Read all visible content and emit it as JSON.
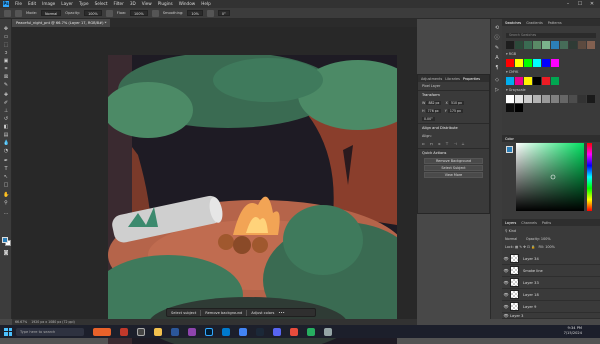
{
  "app": {
    "logo": "Ps",
    "menu": [
      "File",
      "Edit",
      "Image",
      "Layer",
      "Type",
      "Select",
      "Filter",
      "3D",
      "View",
      "Plugins",
      "Window",
      "Help"
    ],
    "window_controls": [
      "–",
      "☐",
      "✕"
    ]
  },
  "options": {
    "mode_label": "Mode:",
    "mode_value": "Normal",
    "opacity_label": "Opacity:",
    "opacity_value": "100%",
    "flow_label": "Flow:",
    "flow_value": "100%",
    "smoothing_label": "Smoothing:",
    "smoothing_value": "10%",
    "angle_value": "0°"
  },
  "document": {
    "tab_title": "Peaceful_night_pnt @ 66.7% (Layer 17, RGB/8#) *",
    "status_zoom": "66.67%",
    "status_size": "1920 px x 1080 px (72 ppi)"
  },
  "contextual_bar": {
    "select_subject": "Select subject",
    "remove_background": "Remove background",
    "adjust_colors": "Adjust colors"
  },
  "properties": {
    "tabs": [
      "Adjustments",
      "Libraries",
      "Properties"
    ],
    "layer_type": "Pixel Layer",
    "transform_label": "Transform",
    "w_label": "W",
    "w_value": "882 px",
    "x_label": "X",
    "x_value": "510 px",
    "h_label": "H",
    "h_value": "776 px",
    "y_label": "Y",
    "y_value": "175 px",
    "angle_value": "0.00°",
    "align_label": "Align and Distribute",
    "align_sub": "Align:",
    "quick_actions_label": "Quick Actions",
    "btn_remove_bg": "Remove Background",
    "btn_select_subject": "Select Subject",
    "btn_view_more": "View More"
  },
  "swatches": {
    "tabs": [
      "Swatches",
      "Gradients",
      "Patterns"
    ],
    "search_placeholder": "Search Swatches",
    "folders": [
      "RGB",
      "CMYK",
      "Grayscale"
    ],
    "recent": [
      "#1e1e1e",
      "#2c4a3a",
      "#3a6b52",
      "#5a8a66",
      "#7bb38c",
      "#2c7fb8",
      "#466c58",
      "#2f3b35",
      "#5c4a3f",
      "#826050"
    ],
    "rgb": [
      "#ff0000",
      "#ffff00",
      "#00ff00",
      "#00ffff",
      "#0000ff",
      "#ff00ff"
    ],
    "cmyk": [
      "#00aeef",
      "#ec008c",
      "#fff200",
      "#000000",
      "#ed1c24",
      "#00a651"
    ],
    "gray": [
      "#ffffff",
      "#e6e6e6",
      "#cccccc",
      "#b3b3b3",
      "#999999",
      "#808080",
      "#666666",
      "#4d4d4d",
      "#333333",
      "#1a1a1a",
      "#0d0d0d",
      "#000000"
    ]
  },
  "color_panel": {
    "tab": "Color",
    "foreground": "#2c7fb8",
    "background": "#ffffff",
    "hue_color": "#00e060"
  },
  "layers": {
    "tabs": [
      "Layers",
      "Channels",
      "Paths"
    ],
    "kind_label": "Kind",
    "blend_value": "Normal",
    "opacity_label": "Opacity:",
    "opacity_value": "100%",
    "lock_label": "Lock:",
    "fill_label": "Fill:",
    "fill_value": "100%",
    "items": [
      "Layer 34",
      "Smoke line",
      "Layer 33",
      "Layer 18",
      "Layer 9",
      "Layer 3"
    ]
  },
  "taskbar": {
    "search_placeholder": "Type here to search",
    "time": "9:34 PM",
    "date": "7/15/2024"
  }
}
